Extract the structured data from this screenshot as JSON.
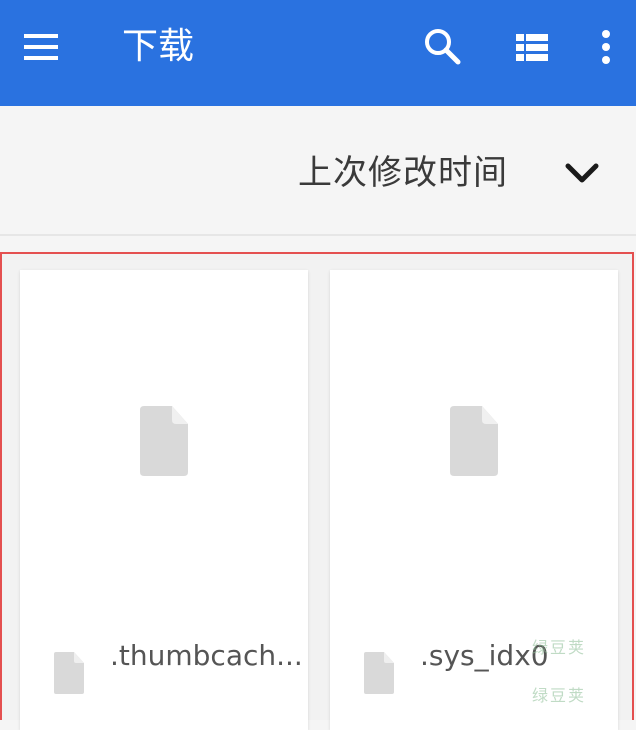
{
  "appbar": {
    "title": "下载",
    "menu_icon": "hamburger-menu-icon",
    "search_icon": "search-icon",
    "view_icon": "list-view-icon",
    "more_icon": "more-vert-icon",
    "background_color": "#2a72e0"
  },
  "sortbar": {
    "label": "上次修改时间",
    "icon": "chevron-down-icon"
  },
  "files": [
    {
      "name": ".thumbcach...",
      "icon": "file-icon"
    },
    {
      "name": ".sys_idx0",
      "icon": "file-icon"
    }
  ],
  "watermark": {
    "line1": "绿豆荚",
    "line2": "绿豆荚"
  },
  "colors": {
    "selection_border": "#e45050",
    "file_icon": "#d9d9d9"
  }
}
